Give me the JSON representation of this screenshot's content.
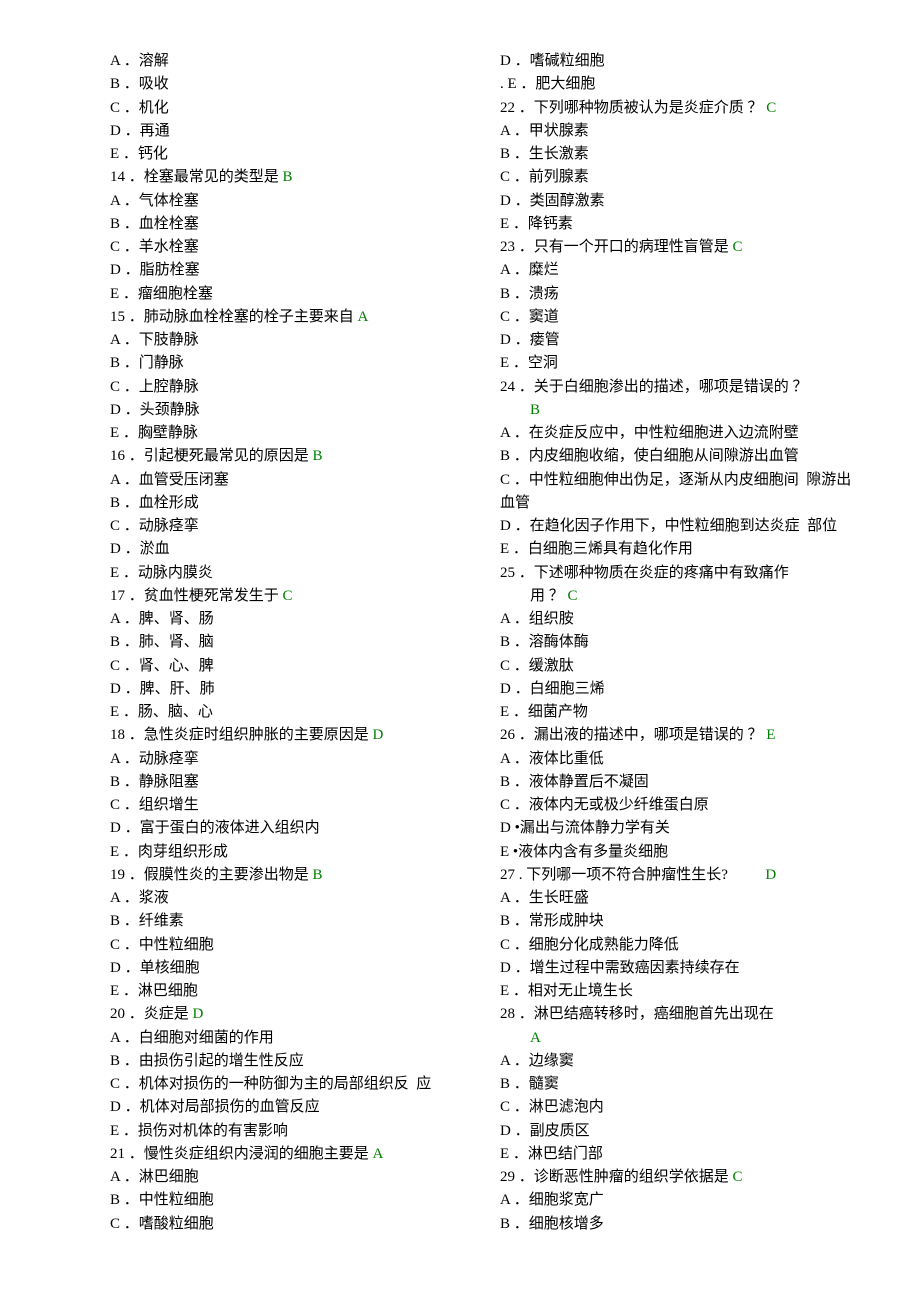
{
  "col1": {
    "opt13": [
      "A ．溶解",
      "B ．吸收",
      "C ．机化",
      "D ．再通",
      "E ．钙化"
    ],
    "q14": {
      "text": "14 ．栓塞最常见的类型是 ",
      "ans": "B"
    },
    "opt14": [
      "A ．气体栓塞",
      "B ．血栓栓塞",
      "C ．羊水栓塞",
      "D ．脂肪栓塞",
      "E ．瘤细胞栓塞"
    ],
    "q15": {
      "text": "15 ．肺动脉血栓栓塞的栓子主要来自 ",
      "ans": "A"
    },
    "opt15": [
      "A ．下肢静脉",
      "B ．门静脉",
      "C ．上腔静脉",
      "D ．头颈静脉",
      "E ．胸壁静脉"
    ],
    "q16": {
      "text": "16 ．引起梗死最常见的原因是 ",
      "ans": "B"
    },
    "opt16": [
      "A ．血管受压闭塞",
      "B ．血栓形成",
      "C ．动脉痉挛",
      "D ．淤血",
      "E ．动脉内膜炎"
    ],
    "q17": {
      "text": "17 ．贫血性梗死常发生于 ",
      "ans": "C"
    },
    "opt17": [
      "A ．脾、肾、肠",
      "B ．肺、肾、脑",
      "C ．肾、心、脾",
      "D ．脾、肝、肺",
      "E ．肠、脑、心"
    ],
    "q18": {
      "text": "18 ．急性炎症时组织肿胀的主要原因是 ",
      "ans": "D"
    },
    "opt18": [
      "A ．动脉痉挛",
      "B ．静脉阻塞",
      "C ．组织增生",
      "D ．富于蛋白的液体进入组织内",
      "E ．肉芽组织形成"
    ],
    "q19": {
      "text": "19 ．假膜性炎的主要渗出物是 ",
      "ans": "B"
    },
    "opt19": [
      "A ．浆液",
      "B ．纤维素",
      "C ．中性粒细胞",
      "D ．单核细胞",
      "E ．淋巴细胞"
    ],
    "q20": {
      "text": "20 ．炎症是 ",
      "ans": "D"
    },
    "opt20": [
      "A ．白细胞对细菌的作用",
      "B ．由损伤引起的增生性反应",
      "C ．机体对损伤的一种防御为主的局部组织反  应",
      "D ．机体对局部损伤的血管反应",
      "E ．损伤对机体的有害影响"
    ],
    "q21": {
      "text": "21 ．慢性炎症组织内浸润的细胞主要是 ",
      "ans": "A"
    },
    "opt21": [
      "A ．淋巴细胞",
      "B ．中性粒细胞",
      "C ．嗜酸粒细胞"
    ]
  },
  "col2": {
    "opt21b": [
      "D ．嗜碱粒细胞",
      ". E ．肥大细胞"
    ],
    "q22": {
      "text": "22 ．下列哪种物质被认为是炎症介质 ？ ",
      "ans": "C"
    },
    "opt22": [
      "A ．甲状腺素",
      "B ．生长激素",
      "C ．前列腺素",
      "D ．类固醇激素",
      "E ．降钙素"
    ],
    "q23": {
      "text": "23 ．只有一个开口的病理性盲管是 ",
      "ans": "C"
    },
    "opt23": [
      "A ．糜烂",
      "B ．溃疡",
      "C ．窦道",
      "D ．瘘管",
      "E ．空洞"
    ],
    "q24": {
      "text": "24 ．关于白细胞渗出的描述，哪项是错误的 ？",
      "ans": "B"
    },
    "opt24": [
      "A ．在炎症反应中，中性粒细胞进入边流附壁",
      "B ．内皮细胞收缩，使白细胞从间隙游出血管",
      "C ．中性粒细胞伸出伪足，逐渐从内皮细胞间  隙游出血管",
      "D ．在趋化因子作用下，中性粒细胞到达炎症  部位",
      "E ．白细胞三烯具有趋化作用"
    ],
    "q25": {
      "text": "25 ．下述哪种物质在炎症的疼痛中有致痛作",
      "text2": "用 ？ ",
      "ans": "C"
    },
    "opt25": [
      "A ．组织胺",
      "B ．溶酶体酶",
      "C ．缓激肽",
      "D ．白细胞三烯",
      "E ．细菌产物"
    ],
    "q26": {
      "text": "26 ．漏出液的描述中，哪项是错误的 ？ ",
      "ans": "E"
    },
    "opt26": [
      "A ．液体比重低",
      "B ．液体静置后不凝固",
      "C ．液体内无或极少纤维蛋白原",
      "D •漏出与流体静力学有关",
      "E •液体内含有多量炎细胞"
    ],
    "q27": {
      "text": "27 . 下列哪一项不符合肿瘤性生长?          ",
      "ans": "D"
    },
    "opt27": [
      "A ．生长旺盛",
      "B ．常形成肿块",
      "C ．细胞分化成熟能力降低",
      "D ．增生过程中需致癌因素持续存在",
      "E ．相对无止境生长"
    ],
    "q28": {
      "text": "28 ．淋巴结癌转移时，癌细胞首先出现在",
      "ans": "A"
    },
    "opt28": [
      "A ．边缘窦",
      "B ．髓窦",
      "C ．淋巴滤泡内",
      "D ．副皮质区",
      "E ．淋巴结门部"
    ],
    "q29": {
      "text": "29 ．诊断恶性肿瘤的组织学依据是 ",
      "ans": "C"
    },
    "opt29": [
      "A ．细胞浆宽广",
      "B ．细胞核增多"
    ]
  }
}
